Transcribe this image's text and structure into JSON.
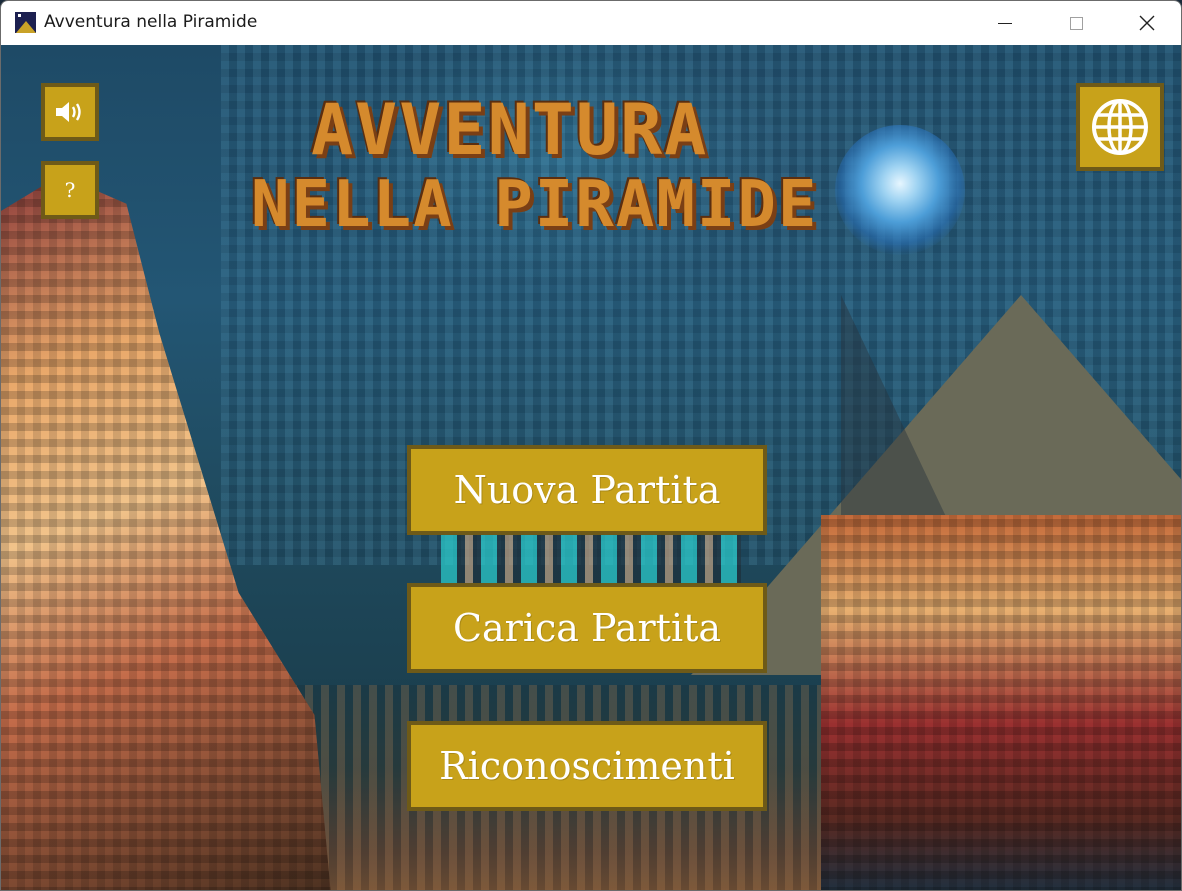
{
  "window": {
    "title": "Avventura nella Piramide",
    "controls": {
      "minimize": "minimize-icon",
      "maximize": "maximize-icon",
      "close": "close-icon"
    }
  },
  "game": {
    "title_line1": "AVVENTURA",
    "title_line2": "NELLA PIRAMIDE"
  },
  "toolbar": {
    "sound_icon": "speaker-icon",
    "help_label": "?",
    "language_icon": "globe-icon"
  },
  "menu": {
    "items": [
      {
        "label": "Nuova Partita"
      },
      {
        "label": "Carica Partita"
      },
      {
        "label": "Riconoscimenti"
      }
    ]
  },
  "colors": {
    "button_fill": "#c8a21a",
    "button_border": "#6e5a18",
    "title_orange": "#d58a2d"
  }
}
